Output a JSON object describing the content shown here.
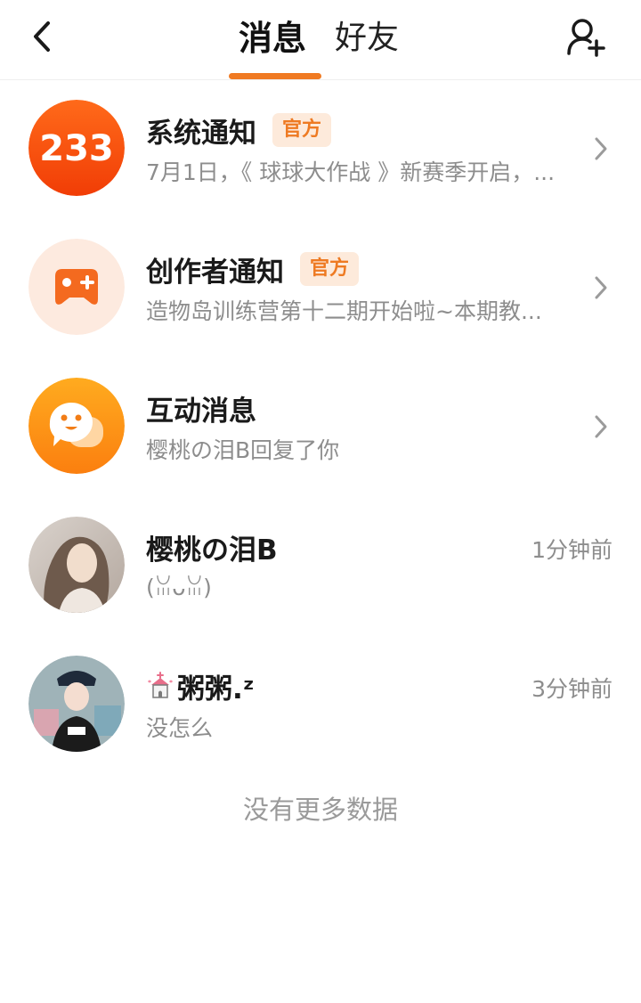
{
  "header": {
    "tabs": [
      {
        "label": "消息",
        "active": true
      },
      {
        "label": "好友",
        "active": false
      }
    ],
    "back_icon": "chevron-left-icon",
    "add_friend_icon": "add-user-icon",
    "accent_color": "#f07a22"
  },
  "messages": [
    {
      "avatar": "233-logo",
      "avatar_text": "233",
      "title": "系统通知",
      "badge": "官方",
      "preview": "7月1日，《 球球大作战 》新赛季开启，...",
      "chevron": true
    },
    {
      "avatar": "gamepad-icon",
      "title": "创作者通知",
      "badge": "官方",
      "preview": "造物岛训练营第十二期开始啦~本期教...",
      "chevron": true
    },
    {
      "avatar": "chat-bubble-icon",
      "title": "互动消息",
      "preview": "樱桃の泪B回复了你",
      "chevron": true
    },
    {
      "avatar": "user-photo",
      "title": "樱桃の泪B",
      "preview": "(ꈍᴗꈍ)",
      "time": "1分钟前"
    },
    {
      "avatar": "user-photo",
      "title": "粥粥.ᶻ",
      "preview": "没怎么",
      "time": "3分钟前"
    }
  ],
  "footer": {
    "no_more": "没有更多数据"
  }
}
